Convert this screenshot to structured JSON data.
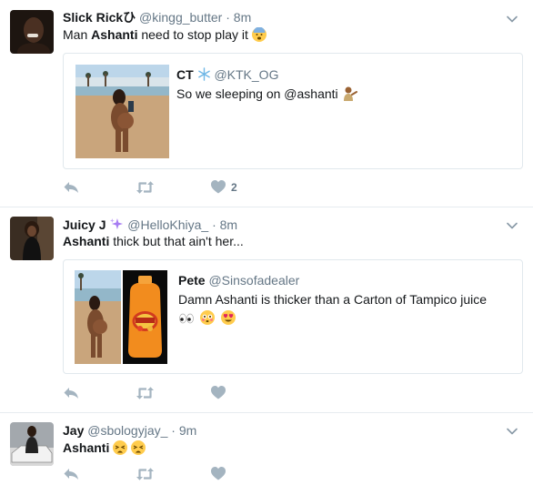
{
  "tweets": [
    {
      "fullname": "Slick Rickひ",
      "username": "@kingg_butter",
      "dot": "·",
      "time": "8m",
      "text_pre": "Man ",
      "text_bold": "Ashanti",
      "text_post": " need to stop play it",
      "quote": {
        "fullname": "CT",
        "username": "@KTK_OG",
        "text": "So we sleeping on @ashanti"
      },
      "like_count": "2"
    },
    {
      "fullname": "Juicy J",
      "username": "@HelloKhiya_",
      "dot": "·",
      "time": "8m",
      "text_bold": "Ashanti",
      "text_post": " thick but that ain't her...",
      "quote": {
        "fullname": "Pete",
        "username": "@Sinsofadealer",
        "text": "Damn Ashanti is thicker than a Carton of Tampico juice"
      }
    },
    {
      "fullname": "Jay",
      "username": "@sbologyjay_",
      "dot": "·",
      "time": "9m",
      "text_bold": "Ashanti"
    }
  ],
  "colors": {
    "secondary_text": "#657786",
    "border": "#e6ecf0",
    "icon": "#a4b4c0",
    "sparkle": "#a77df2"
  },
  "icons": [
    "reply-icon",
    "retweet-icon",
    "like-icon",
    "caret-down-icon",
    "snowflake-icon",
    "sparkles-icon"
  ]
}
